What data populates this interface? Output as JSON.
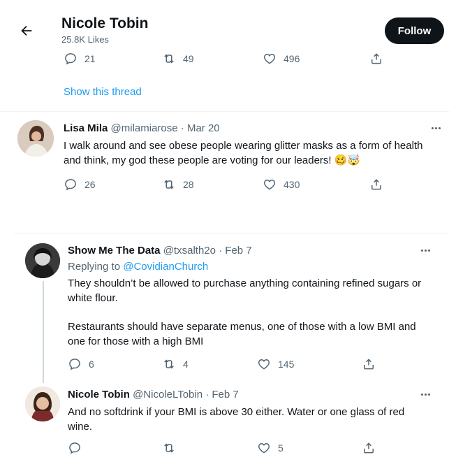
{
  "header": {
    "name": "Nicole Tobin",
    "likes": "25.8K Likes",
    "follow_label": "Follow"
  },
  "top_tweet": {
    "replies": "21",
    "retweets": "49",
    "likes": "496",
    "show_thread": "Show this thread"
  },
  "tweet1": {
    "name": "Lisa Mila",
    "handle": "@milamiarose",
    "date": "· Mar 20",
    "text": "I walk around and see obese people wearing glitter masks as a form of health and think, my god these people are voting for our leaders!",
    "emoji": "🥴🤯",
    "replies": "26",
    "retweets": "28",
    "likes": "430"
  },
  "tweet2": {
    "name": "Show Me The Data",
    "handle": "@txsalth2o",
    "date": "· Feb 7",
    "replying_prefix": "Replying to",
    "replying_to": "@CovidianChurch",
    "text1": "They shouldn’t be allowed to purchase anything containing refined sugars or white flour.",
    "text2": "Restaurants should have separate menus, one of those with a low BMI and one for those with a high BMI",
    "replies": "6",
    "retweets": "4",
    "likes": "145"
  },
  "tweet3": {
    "name": "Nicole Tobin",
    "handle": "@NicoleLTobin",
    "date": "· Feb 7",
    "text": "And no softdrink if your BMI is above 30 either. Water or one glass of red wine.",
    "replies": "",
    "retweets": "",
    "likes": "5"
  },
  "colors": {
    "accent": "#1d9bf0",
    "text": "#0f1419",
    "muted": "#536471",
    "follow_bg": "#0f1419"
  }
}
